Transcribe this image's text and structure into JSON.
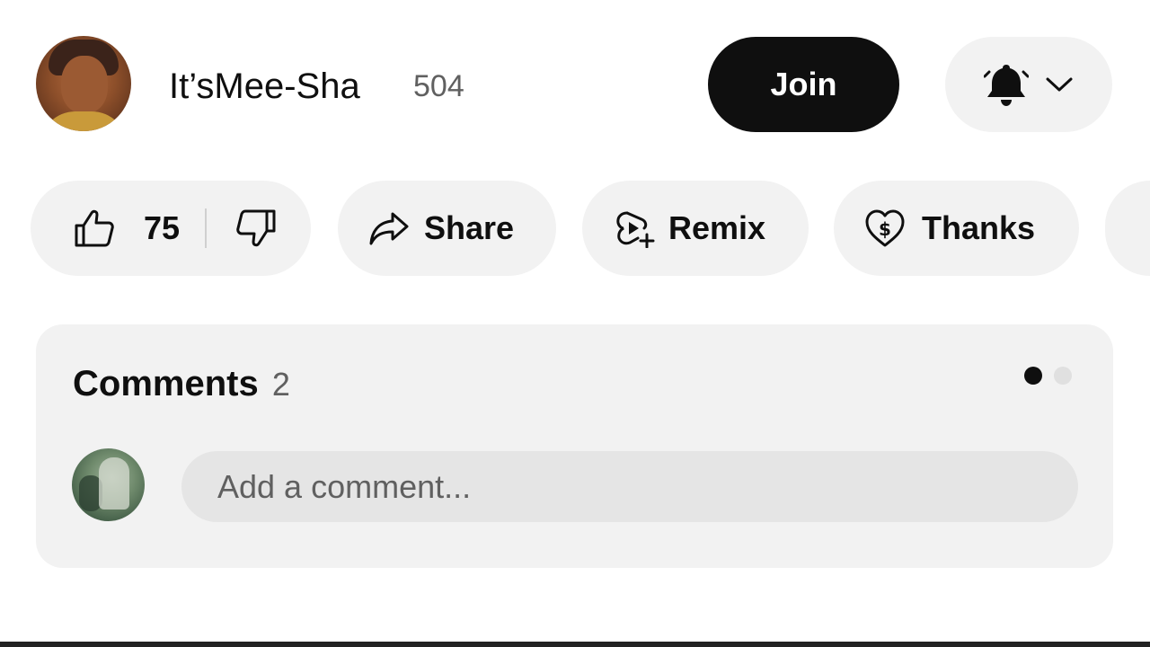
{
  "channel": {
    "name": "It’sMee-Sha",
    "subscriber_count": "504",
    "join_label": "Join"
  },
  "actions": {
    "like_count": "75",
    "share_label": "Share",
    "remix_label": "Remix",
    "thanks_label": "Thanks"
  },
  "comments": {
    "title": "Comments",
    "count": "2",
    "input_placeholder": "Add a comment..."
  },
  "icons": {
    "notifications": "bell-icon",
    "dropdown": "chevron-down-icon",
    "like": "thumbs-up-icon",
    "dislike": "thumbs-down-icon",
    "share": "share-arrow-icon",
    "remix": "remix-icon",
    "thanks": "heart-dollar-icon"
  },
  "colors": {
    "join_background": "#0f0f0f",
    "pill_background": "#f2f2f2",
    "secondary_text": "#606060"
  }
}
